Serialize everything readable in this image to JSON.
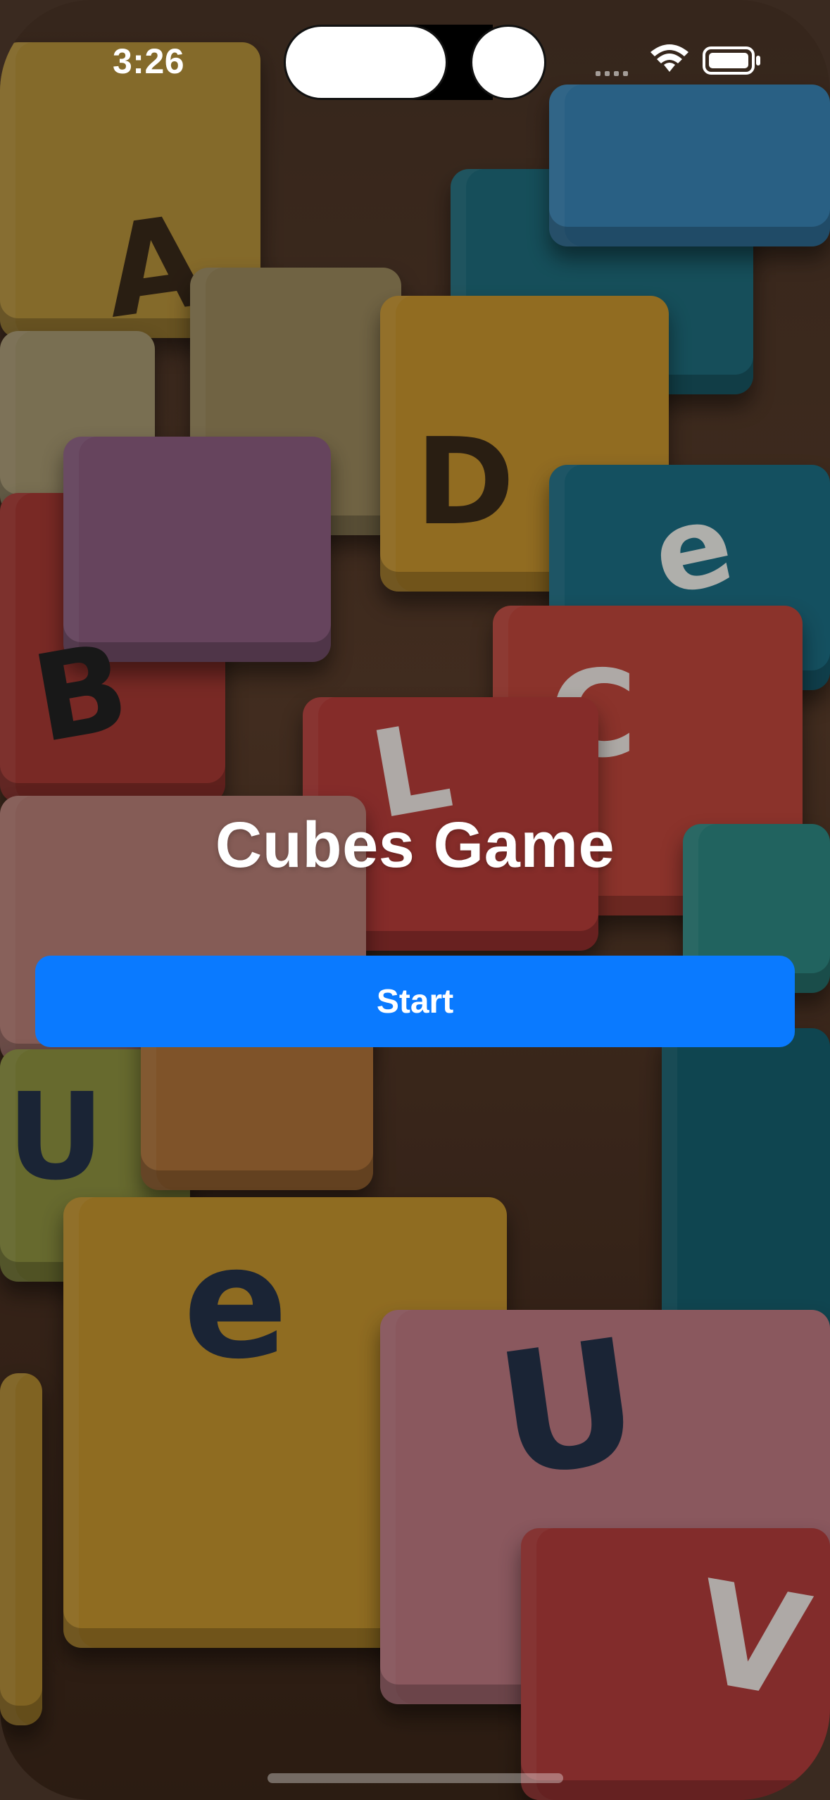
{
  "status_bar": {
    "time": "3:26",
    "icons": [
      "cellular-signal-icon",
      "wifi-icon",
      "battery-icon"
    ]
  },
  "background": {
    "description_icon": "letter-blocks-photo",
    "glyphs": [
      "A",
      "D",
      "B",
      "e",
      "C",
      "L",
      "U",
      "e",
      "U",
      "V"
    ]
  },
  "main": {
    "title": "Cubes Game",
    "start_label": "Start"
  },
  "colors": {
    "accent": "#0a7aff",
    "title": "#ffffff"
  }
}
